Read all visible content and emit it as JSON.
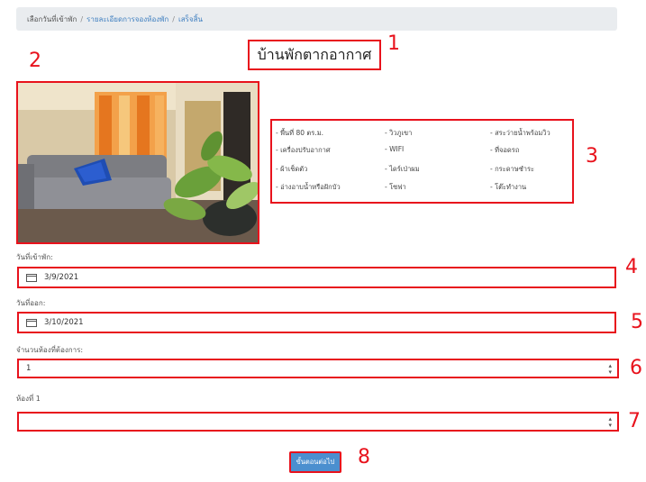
{
  "breadcrumb": {
    "items": [
      "เลือกวันที่เข้าพัก",
      "รายละเอียดการจองห้องพัก",
      "เสร็จสิ้น"
    ],
    "separator": "/"
  },
  "page_title": "บ้านพักตากอากาศ",
  "amenities": [
    "- พื้นที่ 80 ตร.ม.",
    "- วิวภูเขา",
    "- สระว่ายน้ำพร้อมวิว",
    "- เครื่องปรับอากาศ",
    "- WIFI",
    "- ที่จอดรถ",
    "- ผ้าเช็ดตัว",
    "- ไดร์เป่าผม",
    "- กระดาษชำระ",
    "- อ่างอาบน้ำหรือฝักบัว",
    "- โซฟา",
    "- โต๊ะทำงาน"
  ],
  "checkin": {
    "label": "วันที่เข้าพัก:",
    "value": "3/9/2021"
  },
  "checkout": {
    "label": "วันที่ออก:",
    "value": "3/10/2021"
  },
  "rooms_needed": {
    "label": "จำนวนห้องที่ต้องการ:",
    "value": "1"
  },
  "room1": {
    "label": "ห้องที่ 1",
    "value": ""
  },
  "next_button": {
    "label": "ขั้นตอนต่อไป"
  },
  "annotations": [
    "1",
    "2",
    "3",
    "4",
    "5",
    "6",
    "7",
    "8"
  ],
  "colors": {
    "annotation": "#e8121c",
    "link": "#3f7fc0",
    "button": "#4b8fcf",
    "breadcrumb_bg": "#e9ecef"
  }
}
